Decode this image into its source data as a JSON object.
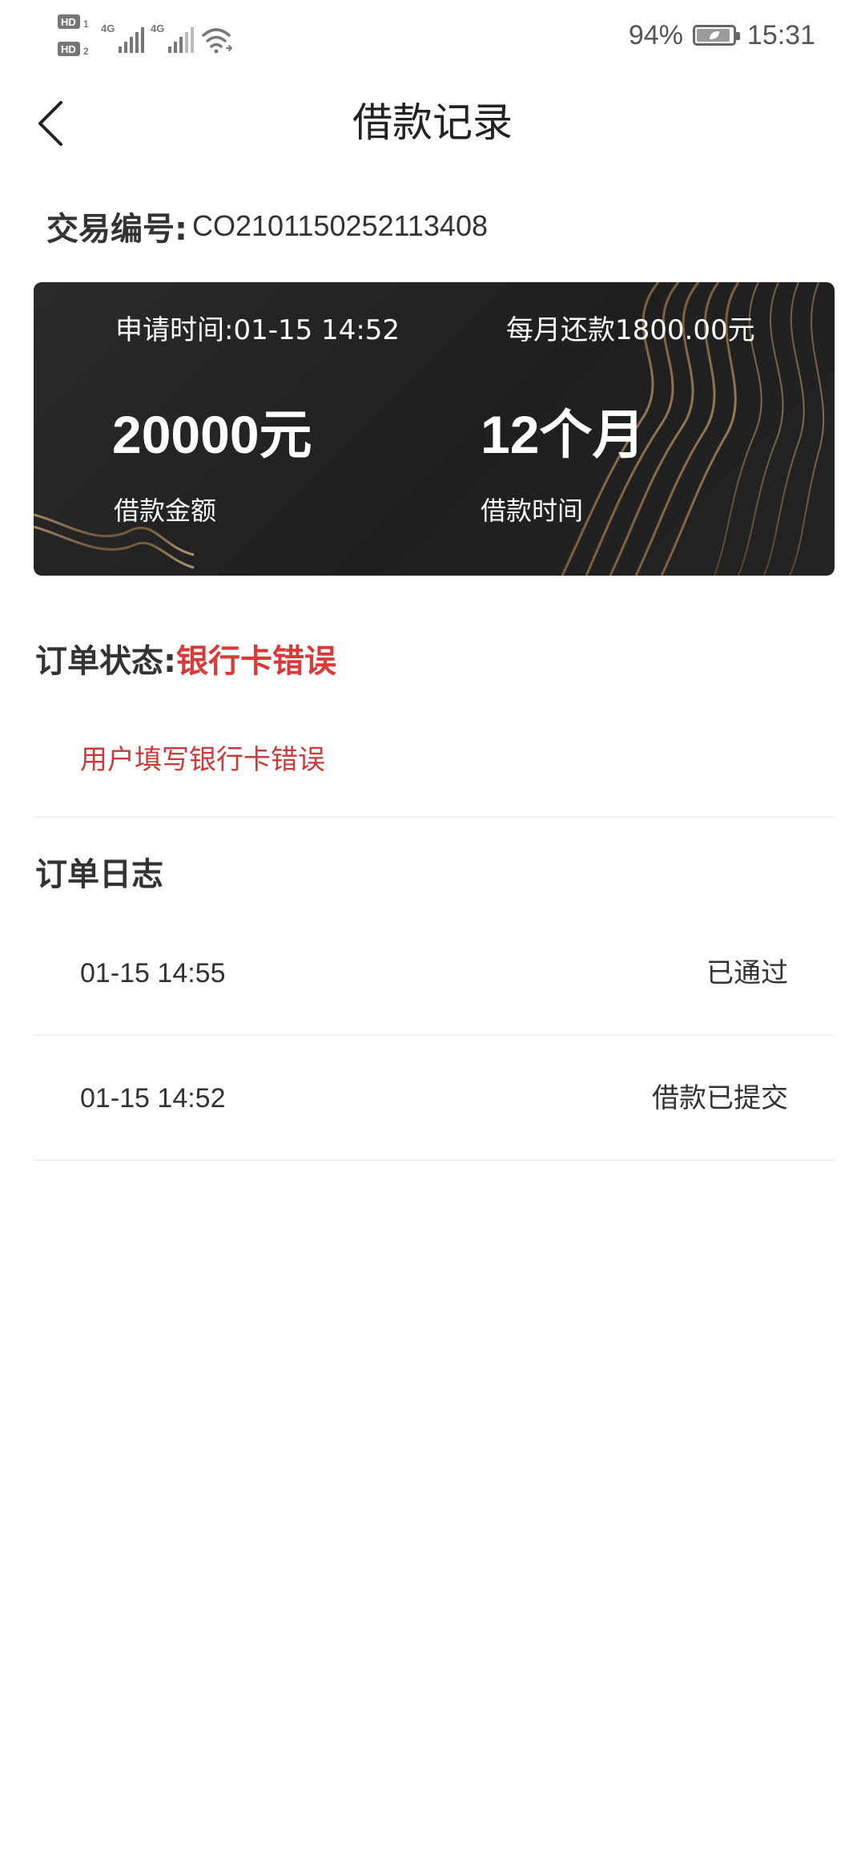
{
  "status_bar": {
    "sim1": "HD",
    "sim1_index": "1",
    "sim2": "HD",
    "sim2_index": "2",
    "network1": "4G",
    "network2": "4G",
    "battery_text": "94%",
    "battery_level": 0.94,
    "time": "15:31"
  },
  "header": {
    "title": "借款记录",
    "back_icon": "chevron-left-icon"
  },
  "transaction": {
    "label": "交易编号:",
    "number": "CO2101150252113408"
  },
  "card": {
    "apply_time": "申请时间:01-15 14:52",
    "monthly_repayment": "每月还款1800.00元",
    "amount": "20000元",
    "amount_label": "借款金额",
    "term": "12个月",
    "term_label": "借款时间",
    "background_color": "#1f1f1f",
    "accent_color": "#b8976a"
  },
  "order_status": {
    "label": "订单状态:",
    "value": "银行卡错误",
    "detail": "用户填写银行卡错误",
    "status_color": "#d83a3a"
  },
  "order_log": {
    "title": "订单日志",
    "entries": [
      {
        "time": "01-15 14:55",
        "description": "已通过"
      },
      {
        "time": "01-15 14:52",
        "description": "借款已提交"
      }
    ]
  }
}
